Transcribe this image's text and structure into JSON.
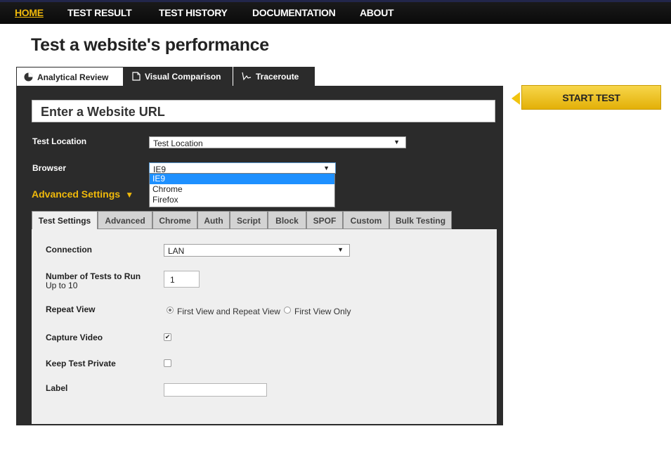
{
  "nav": {
    "items": [
      {
        "label": "HOME"
      },
      {
        "label": "TEST RESULT"
      },
      {
        "label": "TEST HISTORY"
      },
      {
        "label": "DOCUMENTATION"
      },
      {
        "label": "ABOUT"
      }
    ]
  },
  "page": {
    "title": "Test a website's performance"
  },
  "main_tabs": [
    {
      "label": "Analytical Review",
      "icon": "chart-pie-icon"
    },
    {
      "label": "Visual Comparison",
      "icon": "document-icon"
    },
    {
      "label": "Traceroute",
      "icon": "trace-icon"
    }
  ],
  "url": {
    "placeholder": "Enter a Website URL"
  },
  "start_button": {
    "label": "START TEST"
  },
  "test_location": {
    "label": "Test Location",
    "value": "Test Location"
  },
  "browser": {
    "label": "Browser",
    "value": "IE9",
    "options": [
      "IE9",
      "Chrome",
      "Firefox"
    ]
  },
  "advanced_settings": {
    "label": "Advanced Settings"
  },
  "sub_tabs": [
    "Test Settings",
    "Advanced",
    "Chrome",
    "Auth",
    "Script",
    "Block",
    "SPOF",
    "Custom",
    "Bulk Testing"
  ],
  "settings": {
    "connection": {
      "label": "Connection",
      "value": "LAN"
    },
    "num_tests": {
      "label": "Number of Tests to Run",
      "sublabel": "Up to 10",
      "value": "1"
    },
    "repeat_view": {
      "label": "Repeat View",
      "option1": "First View and Repeat View",
      "option2": "First View Only"
    },
    "capture_video": {
      "label": "Capture Video",
      "checked": true
    },
    "keep_private": {
      "label": "Keep Test Private",
      "checked": false
    },
    "label": {
      "label": "Label",
      "value": ""
    }
  }
}
